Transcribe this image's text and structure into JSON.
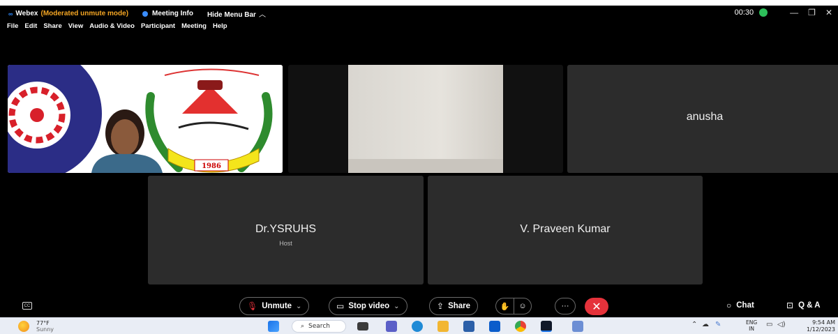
{
  "title_bar": {
    "app_name": "Webex",
    "mode": "(Moderated unmute mode)",
    "meeting_info": "Meeting Info",
    "hide_menu": "Hide Menu Bar",
    "hide_menu_chevron": "︿",
    "timer": "00:30",
    "minimize": "—",
    "restore": "❐",
    "close": "✕"
  },
  "menu": [
    "File",
    "Edit",
    "Share",
    "View",
    "Audio & Video",
    "Participant",
    "Meeting",
    "Help"
  ],
  "tiles": {
    "video1_logo_year": "1986",
    "anusha": {
      "name": "anusha"
    },
    "host": {
      "name": "Dr.YSRUHS",
      "role": "Host"
    },
    "praveen": {
      "name": "V. Praveen Kumar"
    }
  },
  "controls": {
    "unmute": "Unmute",
    "stop_video": "Stop video",
    "share": "Share",
    "more": "···",
    "end": "✕",
    "chat": "Chat",
    "qa": "Q & A",
    "captions": "CC"
  },
  "taskbar": {
    "temperature": "77°F",
    "weather": "Sunny",
    "search": "Search",
    "lang_top": "ENG",
    "lang_bottom": "IN",
    "time": "9:54 AM",
    "date": "1/12/2023"
  },
  "colors": {
    "meeting_bg": "#000000",
    "tile_bg": "#2c2c2c",
    "end_call": "#e5323b",
    "moderated_text": "#f5a623",
    "recording": "#2dbf5a"
  }
}
